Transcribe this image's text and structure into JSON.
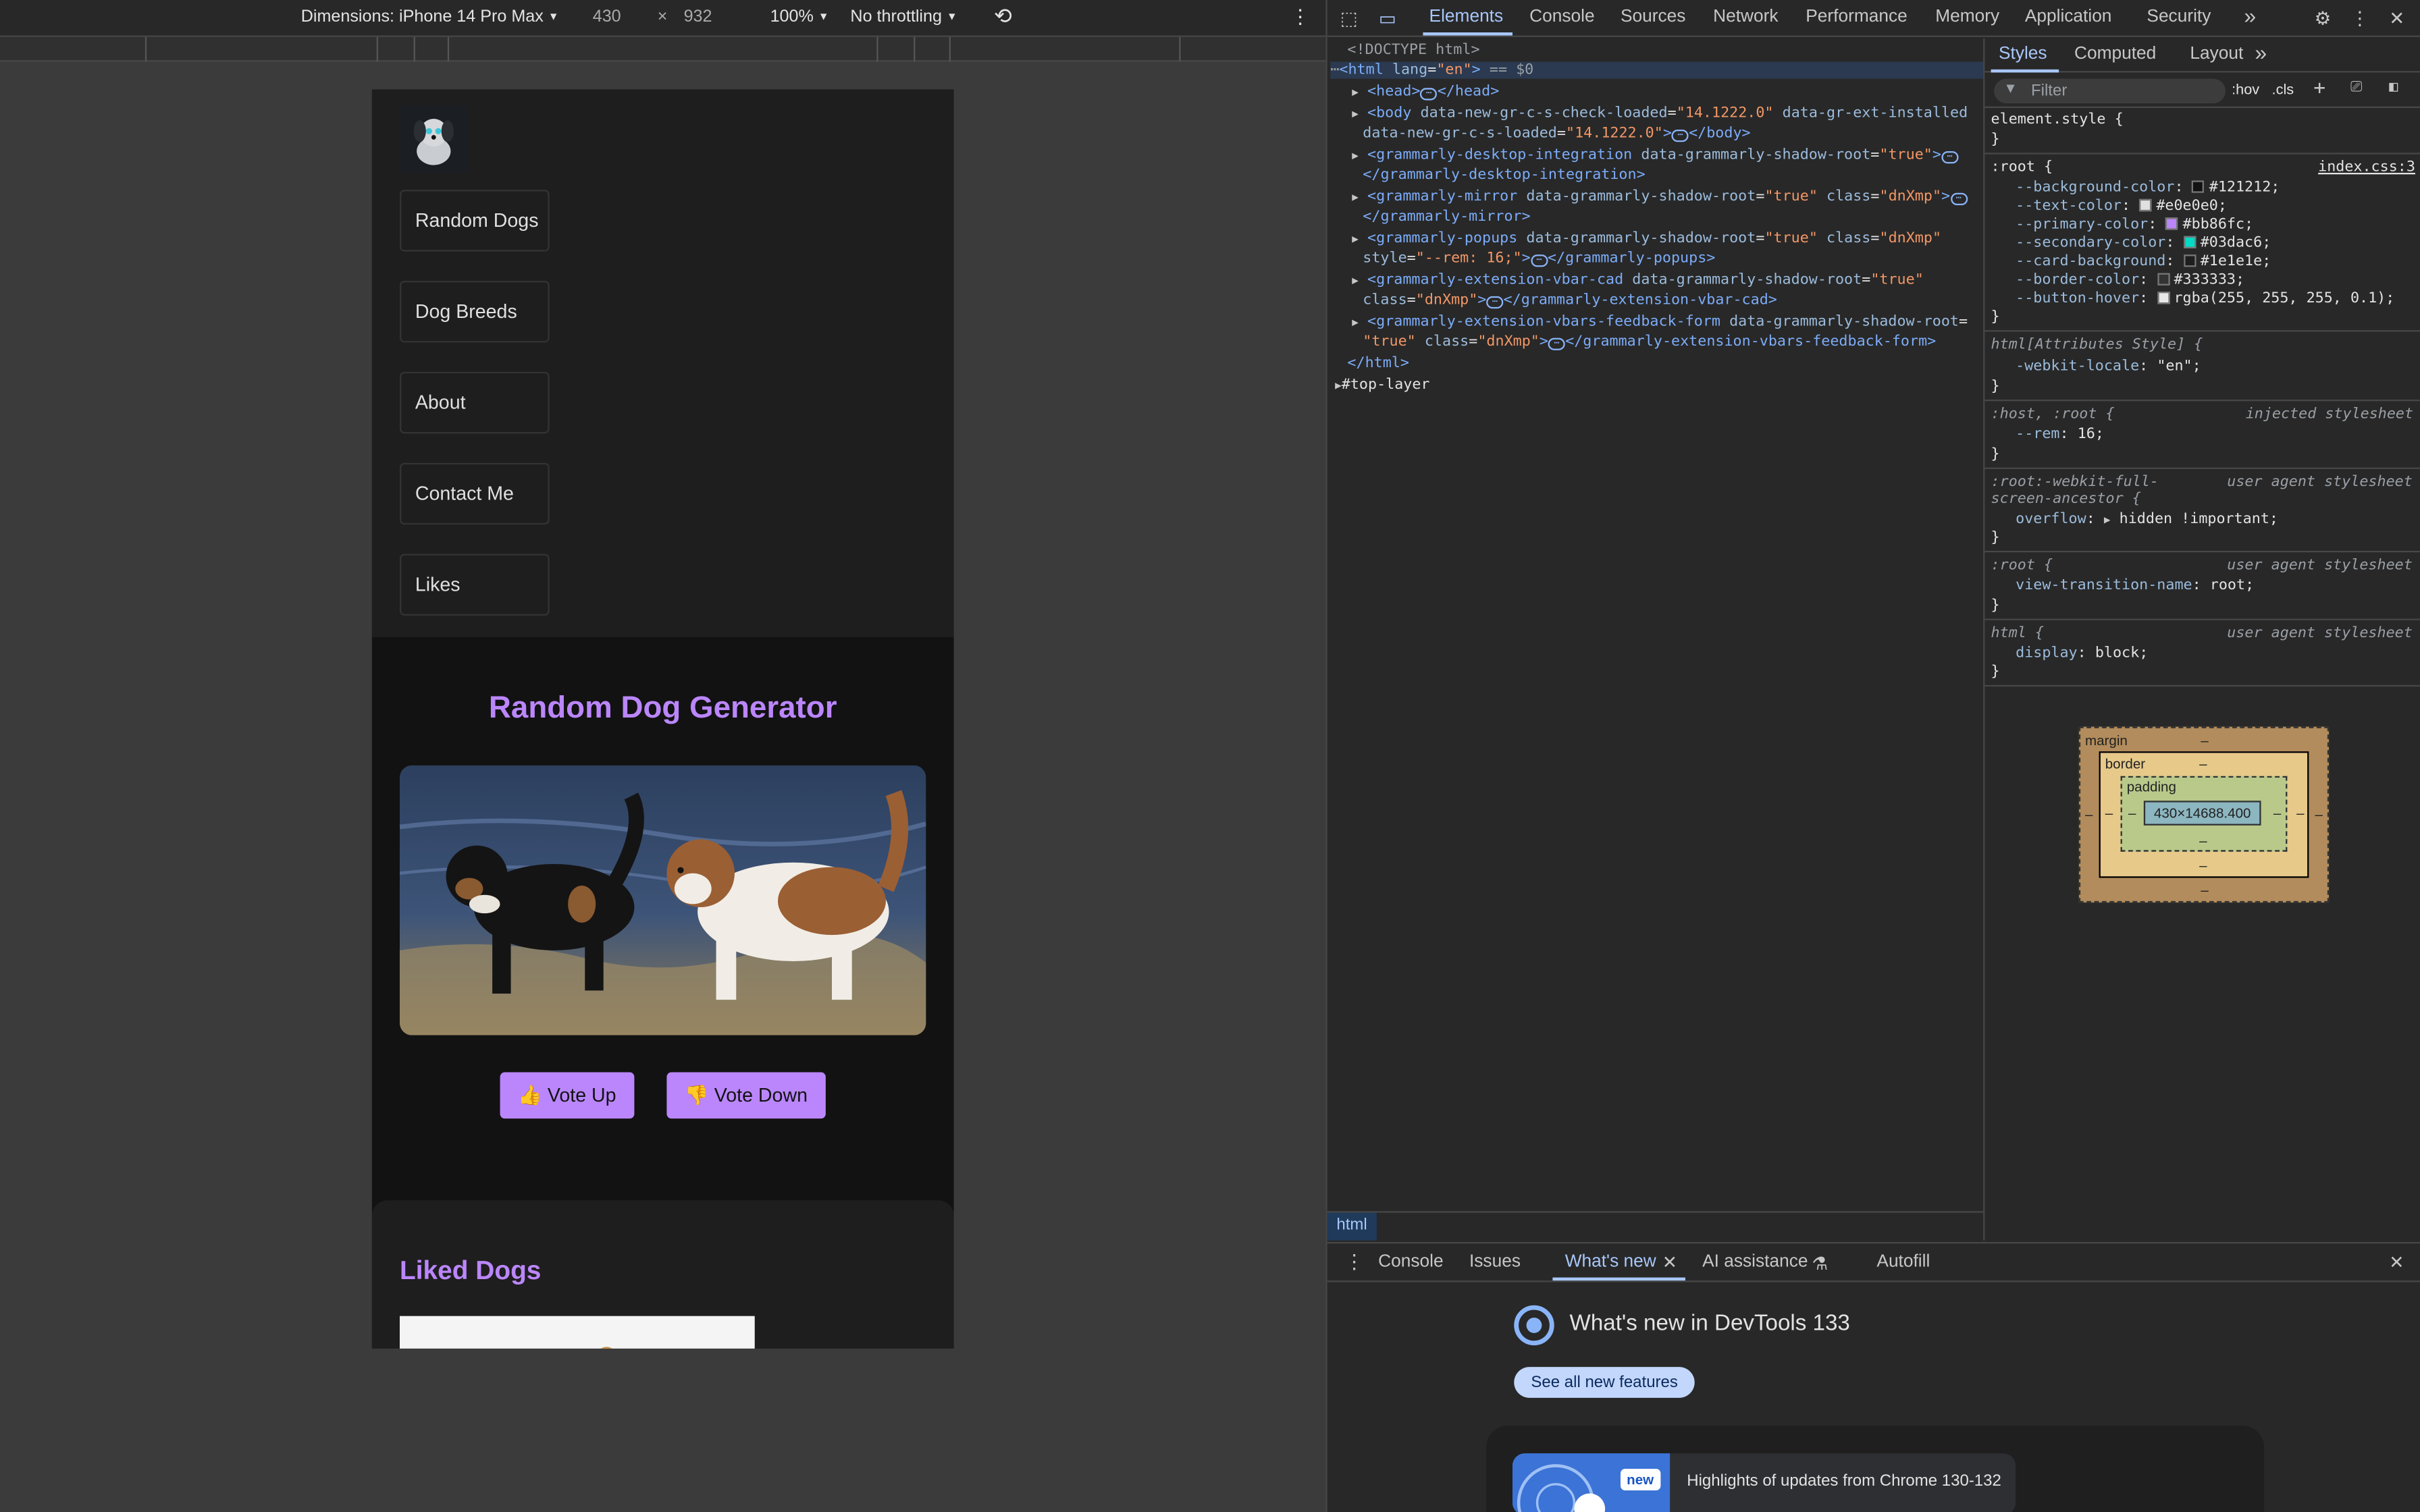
{
  "device_toolbar": {
    "dimensions_label": "Dimensions: iPhone 14 Pro Max",
    "width": "430",
    "times": "×",
    "height": "932",
    "zoom": "100%",
    "throttling": "No throttling"
  },
  "page": {
    "nav_items": [
      "Random Dogs",
      "Dog Breeds",
      "About",
      "Contact Me",
      "Likes"
    ],
    "generator_title": "Random Dog Generator",
    "vote_up": "👍 Vote Up",
    "vote_down": "👎 Vote Down",
    "liked_title": "Liked Dogs"
  },
  "devtools": {
    "tabs": [
      "Elements",
      "Console",
      "Sources",
      "Network",
      "Performance",
      "Memory",
      "Application",
      "Security"
    ],
    "active_tab": "Elements",
    "more_tabs": "»",
    "breadcrumb": "html",
    "styles_tabs": [
      "Styles",
      "Computed",
      "Layout"
    ],
    "styles_more": "»",
    "filter_placeholder": "Filter",
    "hov": ":hov",
    "cls": ".cls",
    "dom": {
      "doctype": "<!DOCTYPE html>",
      "html_open_tag": "html",
      "html_attr": "lang",
      "html_attr_val": "\"en\"",
      "html_suffix": "== $0",
      "head": "head",
      "body_attr1": "data-new-gr-c-s-check-loaded",
      "body_val1": "\"14.1222.0\"",
      "body_attr2": "data-gr-ext-installed",
      "body_attr3": "data-new-gr-c-s-loaded",
      "body_val3": "\"14.1222.0\"",
      "gram1": "grammarly-desktop-integration",
      "gram2": "grammarly-mirror",
      "gram3": "grammarly-popups",
      "gram4": "grammarly-extension-vbar-cad",
      "gram5": "grammarly-extension-vbars-feedback-form",
      "shadow_attr": "data-grammarly-shadow-root",
      "true_val": "\"true\"",
      "class_attr": "class",
      "dnxmp": "\"dnXmp\"",
      "style_attr": "style",
      "style_val": "\"--rem: 16;\"",
      "top_layer": "#top-layer"
    },
    "styles": {
      "element_style": "element.style {",
      "root_sel": ":root {",
      "root_source": "index.css:3",
      "vars": [
        {
          "name": "--background-color",
          "value": "#121212",
          "swatch": "#121212"
        },
        {
          "name": "--text-color",
          "value": "#e0e0e0",
          "swatch": "#e0e0e0"
        },
        {
          "name": "--primary-color",
          "value": "#bb86fc",
          "swatch": "#bb86fc"
        },
        {
          "name": "--secondary-color",
          "value": "#03dac6",
          "swatch": "#03dac6"
        },
        {
          "name": "--card-background",
          "value": "#1e1e1e",
          "swatch": "#1e1e1e"
        },
        {
          "name": "--border-color",
          "value": "#333333",
          "swatch": "#333333"
        },
        {
          "name": "--button-hover",
          "value": "rgba(255, 255, 255, 0.1)",
          "swatch": "#e8e8e8"
        }
      ],
      "attr_style_sel": "html[Attributes Style] {",
      "webkit_locale_prop": "-webkit-locale",
      "webkit_locale_val": "\"en\"",
      "host_root_sel": ":host, :root {",
      "injected": "injected stylesheet",
      "rem_prop": "--rem",
      "rem_val": "16",
      "fullscreen_sel": ":root:-webkit-full-",
      "fullscreen_sel2": "screen-ancestor {",
      "user_agent": "user agent stylesheet",
      "overflow_prop": "overflow",
      "overflow_val": "hidden !important",
      "root_sel2": ":root {",
      "vtn_prop": "view-transition-name",
      "vtn_val": "root",
      "html_sel": "html {",
      "display_prop": "display",
      "display_val": "block",
      "close_brace": "}"
    },
    "box_model": {
      "margin_label": "margin",
      "border_label": "border",
      "padding_label": "padding",
      "dash": "–",
      "content_size": "430×14688.400"
    },
    "drawer": {
      "tabs": [
        "Console",
        "Issues",
        "What's new",
        "AI assistance",
        "Autofill"
      ],
      "active_tab": "What's new",
      "whats_new_title": "What's new in DevTools 133",
      "see_all": "See all new features",
      "new_badge": "new",
      "highlight": "Highlights of updates from Chrome 130-132"
    }
  },
  "colors": {
    "primary": "#bb86fc",
    "background": "#121212",
    "card": "#1e1e1e",
    "devtools_accent": "#a8c7fa"
  }
}
